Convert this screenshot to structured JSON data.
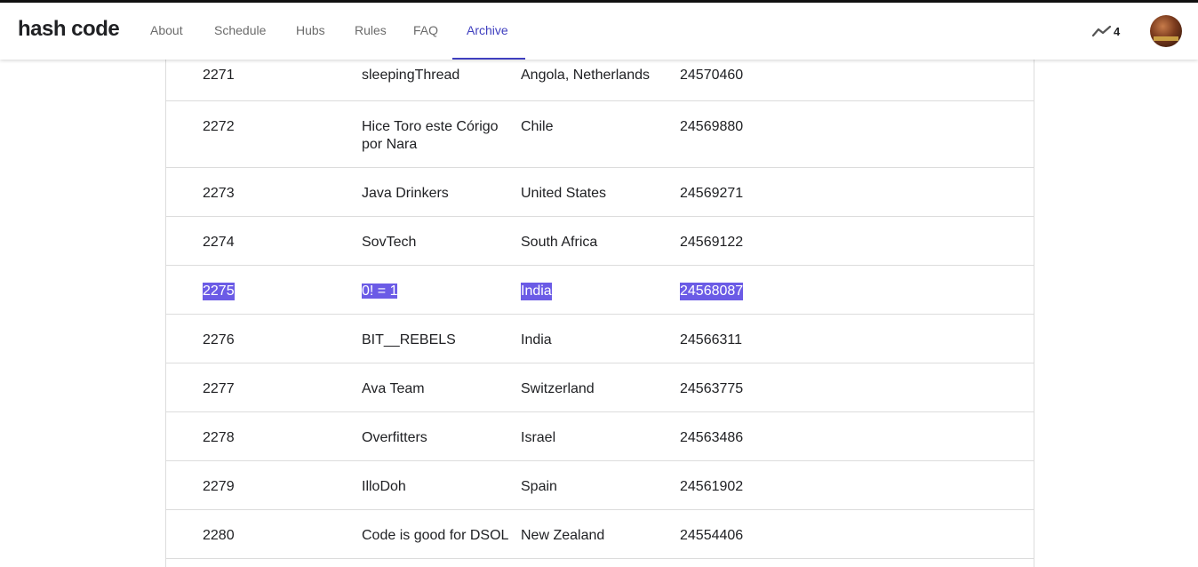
{
  "header": {
    "logo": "hash code",
    "nav": [
      {
        "label": "About",
        "active": false
      },
      {
        "label": "Schedule",
        "active": false
      },
      {
        "label": "Hubs",
        "active": false
      },
      {
        "label": "Rules",
        "active": false
      },
      {
        "label": "FAQ",
        "active": false
      },
      {
        "label": "Archive",
        "active": true
      }
    ],
    "trend_count": "4",
    "trend_icon": "trending-up-icon",
    "avatar_icon": "user-avatar"
  },
  "colors": {
    "accent": "#3f3fbf",
    "selection": "#6b5be6"
  },
  "table": {
    "rows": [
      {
        "rank": "2271",
        "team": "sleepingThread",
        "country": "Angola, Netherlands",
        "score": "24570460"
      },
      {
        "rank": "2272",
        "team": "Hice Toro este Córigo por Nara",
        "country": "Chile",
        "score": "24569880"
      },
      {
        "rank": "2273",
        "team": "Java Drinkers",
        "country": "United States",
        "score": "24569271"
      },
      {
        "rank": "2274",
        "team": "SovTech",
        "country": "South Africa",
        "score": "24569122"
      },
      {
        "rank": "2275",
        "team": "0! = 1",
        "country": "India",
        "score": "24568087",
        "selected": true
      },
      {
        "rank": "2276",
        "team": "BIT__REBELS",
        "country": "India",
        "score": "24566311"
      },
      {
        "rank": "2277",
        "team": "Ava Team",
        "country": "Switzerland",
        "score": "24563775"
      },
      {
        "rank": "2278",
        "team": "Overfitters",
        "country": "Israel",
        "score": "24563486"
      },
      {
        "rank": "2279",
        "team": "IlloDoh",
        "country": "Spain",
        "score": "24561902"
      },
      {
        "rank": "2280",
        "team": "Code is good for DSOL",
        "country": "New Zealand",
        "score": "24554406"
      }
    ]
  }
}
